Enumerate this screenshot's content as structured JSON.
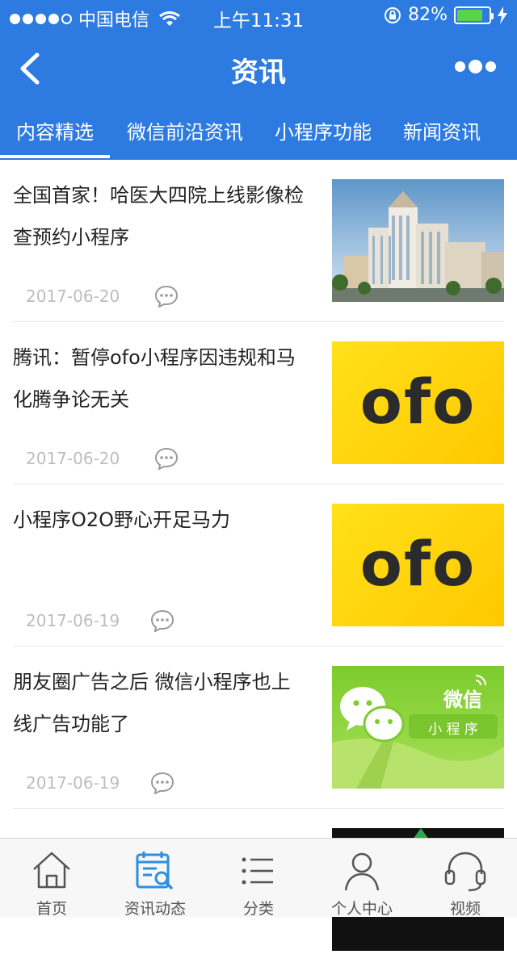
{
  "status_bar": {
    "carrier": "中国电信",
    "time": "上午11:31",
    "battery": "82%",
    "battery_level": 0.82,
    "signal_bars": 4
  },
  "nav": {
    "title": "资讯",
    "back_icon": "chevron-left-icon",
    "more_icon": "more-dots-icon"
  },
  "tabs": [
    {
      "label": "内容精选",
      "active": true
    },
    {
      "label": "微信前沿资讯",
      "active": false
    },
    {
      "label": "小程序功能",
      "active": false
    },
    {
      "label": "新闻资讯",
      "active": false
    }
  ],
  "articles": [
    {
      "title": "全国首家！哈医大四院上线影像检查预约小程序",
      "date": "2017-06-20",
      "thumb": "hospital-building-image"
    },
    {
      "title": "腾讯：暂停ofo小程序因违规和马化腾争论无关",
      "date": "2017-06-20",
      "thumb": "ofo-logo-image",
      "thumb_text": "ofo"
    },
    {
      "title": "小程序O2O野心开足马力",
      "date": "2017-06-19",
      "thumb": "ofo-logo-image",
      "thumb_text": "ofo"
    },
    {
      "title": "朋友圈广告之后 微信小程序也上线广告功能了",
      "date": "2017-06-19",
      "thumb": "wechat-miniprogram-image",
      "thumb_text_1": "微信",
      "thumb_text_2": "小 程 序"
    }
  ],
  "tabbar": [
    {
      "label": "首页",
      "icon": "home-icon"
    },
    {
      "label": "资讯动态",
      "icon": "news-calendar-icon",
      "active": true
    },
    {
      "label": "分类",
      "icon": "list-icon"
    },
    {
      "label": "个人中心",
      "icon": "person-icon"
    },
    {
      "label": "视频",
      "icon": "headset-icon"
    }
  ],
  "colors": {
    "brand": "#2d7be0",
    "battery": "#5ad447",
    "ofo_yellow": "#ffd400",
    "wechat_green": "#8fd137",
    "active_icon": "#2d8fe0"
  }
}
